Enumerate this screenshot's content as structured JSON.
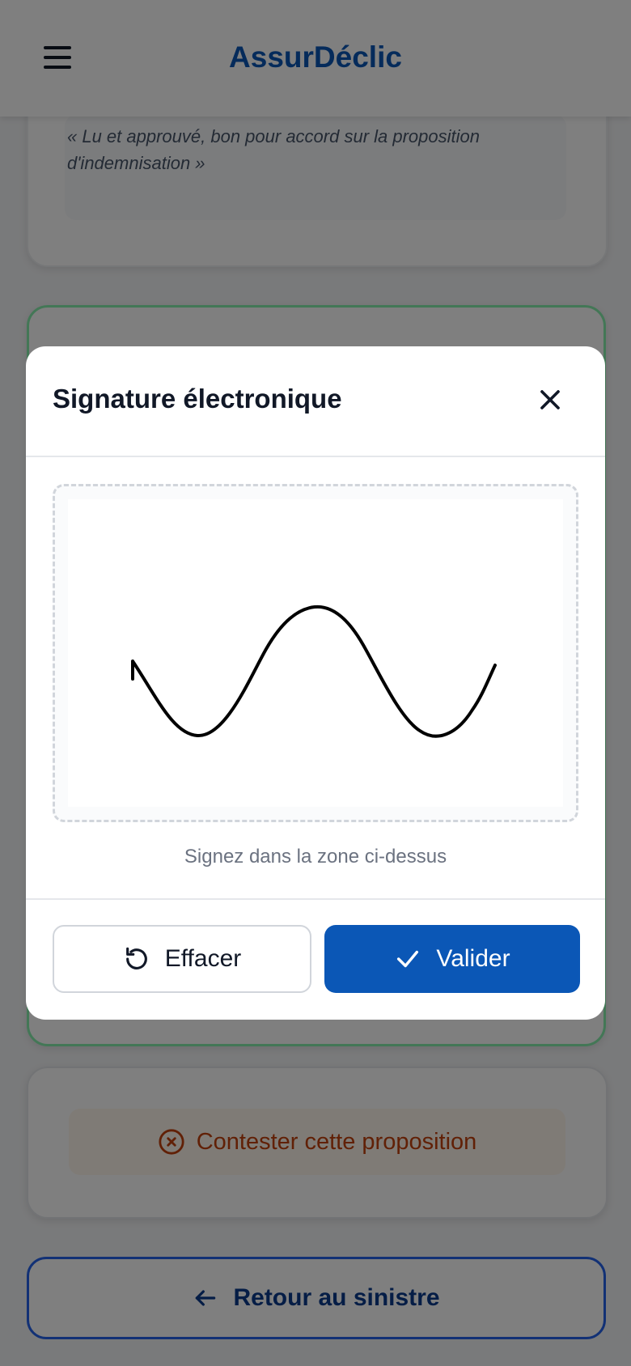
{
  "app": {
    "brand": "AssurDéclic"
  },
  "background": {
    "quote": "« Lu et approuvé, bon pour accord sur la proposition d'indemnisation »",
    "contest_label": "Contester cette proposition",
    "back_label": "Retour au sinistre"
  },
  "modal": {
    "title": "Signature électronique",
    "hint": "Signez dans la zone ci-dessus",
    "clear_label": "Effacer",
    "validate_label": "Valider"
  },
  "icons": {
    "menu": "hamburger-icon",
    "close": "close-icon",
    "clear": "refresh-icon",
    "validate": "check-icon",
    "contest": "circle-x-icon",
    "back": "arrow-left-icon"
  },
  "colors": {
    "brand": "#0b57b6",
    "validate_bg": "#0b57b6",
    "contest_text": "#c2410c",
    "card_border_green": "#86efac",
    "back_border": "#2563eb"
  }
}
